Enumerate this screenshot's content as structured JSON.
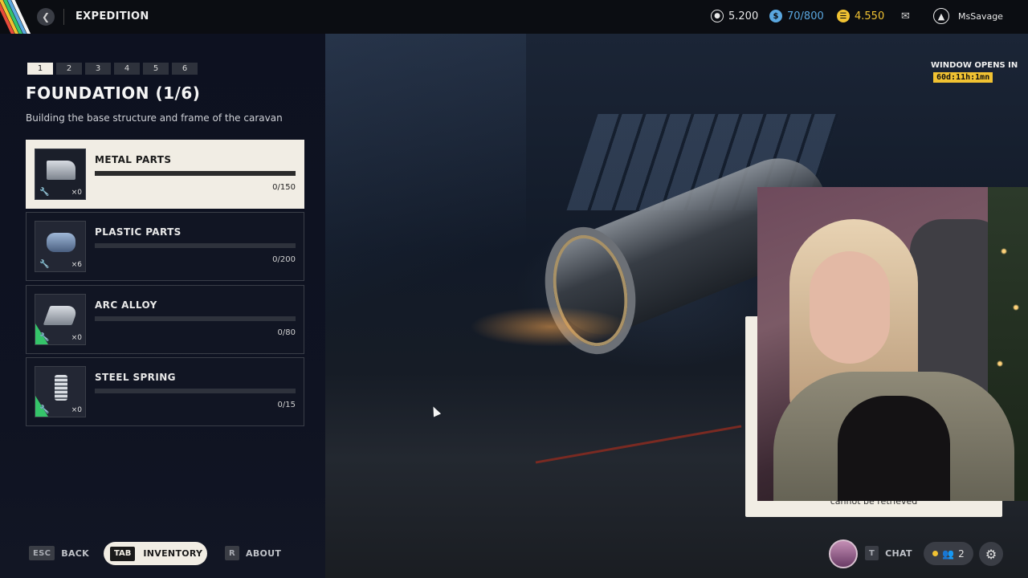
{
  "topbar": {
    "title": "EXPEDITION",
    "back_icon": "chevron-left-icon",
    "currencies": [
      {
        "name": "raider-coins",
        "icon": "coin-stack-icon",
        "value": "5.200",
        "color": "#e8e8e8"
      },
      {
        "name": "cred",
        "icon": "cred-icon",
        "value": "70/800",
        "color": "#5aa7e0"
      },
      {
        "name": "tokens",
        "icon": "token-icon",
        "value": "4.550",
        "color": "#f1c232"
      }
    ],
    "mail_icon": "mail-icon",
    "rank_icon": "rank-chevron-icon",
    "username": "MsSavage"
  },
  "stage": {
    "pages": [
      "1",
      "2",
      "3",
      "4",
      "5",
      "6"
    ],
    "active_page": 1,
    "title": "FOUNDATION (1/6)",
    "subtitle": "Building the base structure and frame of the caravan"
  },
  "materials": [
    {
      "name": "METAL PARTS",
      "owned": "×0",
      "progress": "0/150",
      "fill": 0
    },
    {
      "name": "PLASTIC PARTS",
      "owned": "×6",
      "progress": "0/200",
      "fill": 0
    },
    {
      "name": "ARC ALLOY",
      "owned": "×0",
      "progress": "0/80",
      "fill": 0
    },
    {
      "name": "STEEL SPRING",
      "owned": "×0",
      "progress": "0/15",
      "fill": 0
    }
  ],
  "timer": {
    "label": "WINDOW OPENS IN",
    "value": "60d:11h:1mn"
  },
  "stream_overlay": {
    "caption": "cannot be retrieved"
  },
  "bottom": {
    "back_key": "ESC",
    "back_label": "BACK",
    "inventory_key": "TAB",
    "inventory_label": "INVENTORY",
    "about_key": "R",
    "about_label": "ABOUT",
    "chat_key": "T",
    "chat_label": "CHAT",
    "party_count": "2"
  },
  "colors": {
    "accent_cream": "#f1ede4",
    "uncommon_green": "#35c46a",
    "timer_yellow": "#f1c232"
  }
}
